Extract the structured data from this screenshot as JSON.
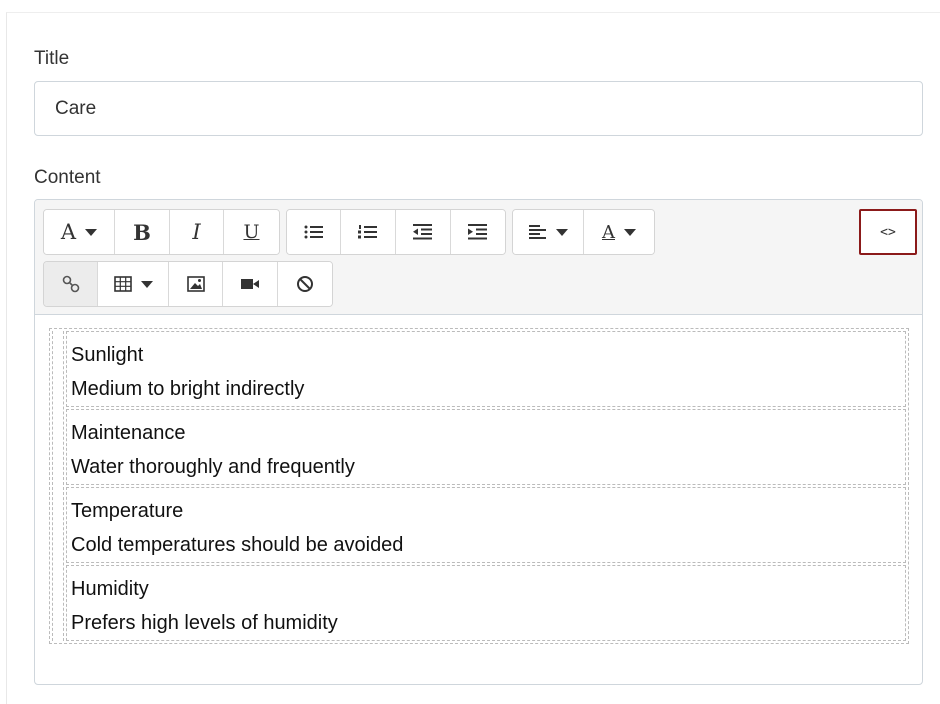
{
  "form": {
    "title_label": "Title",
    "title_value": "Care",
    "content_label": "Content"
  },
  "toolbar": {
    "font_size": "A",
    "bold": "B",
    "italic": "I",
    "underline": "U",
    "text_color": "A",
    "html_toggle": "<>"
  },
  "content_rows": [
    {
      "heading": "Sunlight",
      "text": "Medium to bright indirectly"
    },
    {
      "heading": "Maintenance",
      "text": "Water thoroughly and frequently"
    },
    {
      "heading": "Temperature",
      "text": "Cold temperatures should be avoided"
    },
    {
      "heading": "Humidity",
      "text": "Prefers high levels of humidity"
    }
  ],
  "colors": {
    "html_toggle_border": "#8b1a1a",
    "toolbar_bg": "#f5f5f5",
    "border": "#cfd6dc"
  }
}
